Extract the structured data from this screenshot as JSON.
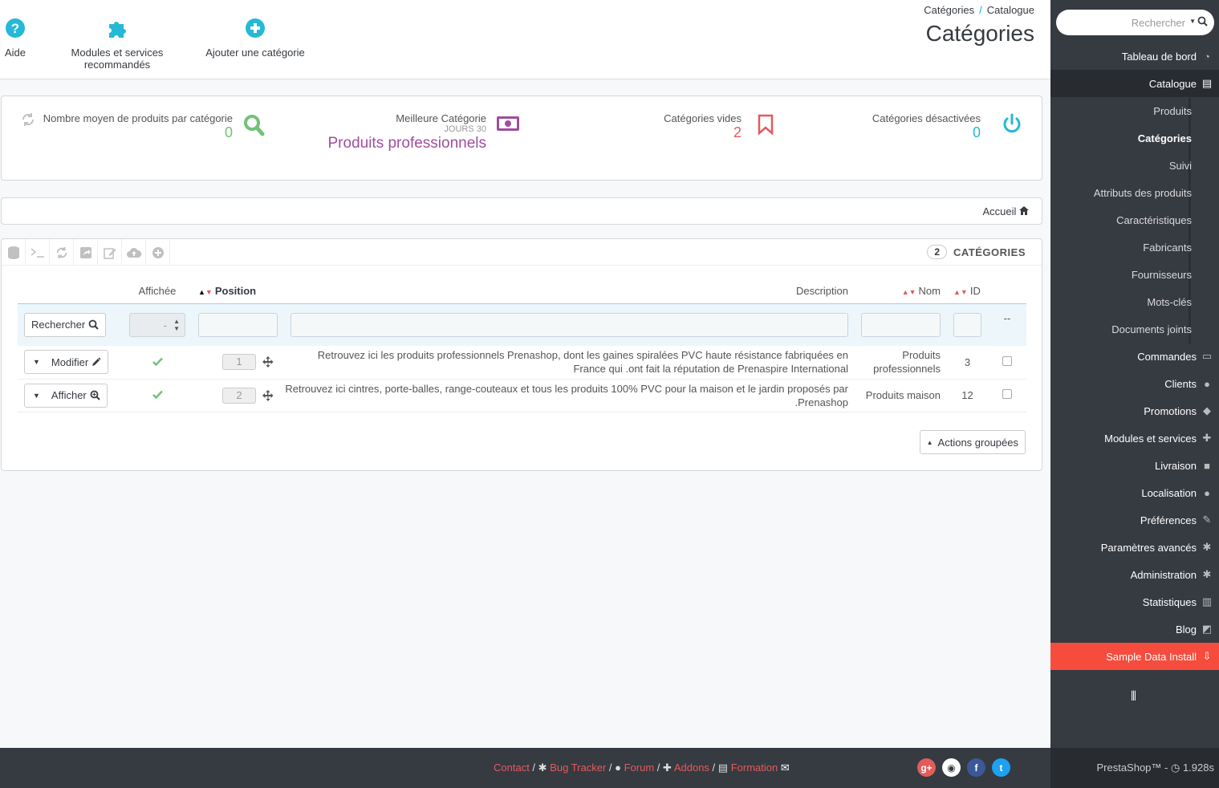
{
  "toolbar": {
    "help": "Aide",
    "modules": "Modules et services recommandés",
    "add": "Ajouter une catégorie"
  },
  "breadcrumb": {
    "parent": "Catégories",
    "sep": "/",
    "current": "Catalogue"
  },
  "page_title": "Catégories",
  "kpis": {
    "avg": {
      "title": "Nombre moyen de produits par catégorie",
      "value": "0"
    },
    "best": {
      "title": "Meilleure Catégorie",
      "sub": "JOURS 30",
      "value": "Produits professionnels"
    },
    "empty": {
      "title": "Catégories vides",
      "value": "2"
    },
    "disabled": {
      "title": "Catégories désactivées",
      "value": "0"
    }
  },
  "path": {
    "home": "Accueil"
  },
  "list": {
    "count": "2",
    "title": "CATÉGORIES",
    "columns": {
      "displayed": "Affichée",
      "position": "Position",
      "description": "Description",
      "name": "Nom",
      "id": "ID"
    },
    "search_button": "Rechercher",
    "select_placeholder": "-",
    "dash": "--",
    "rows": [
      {
        "action": "Modifier",
        "position": "1",
        "description": "Retrouvez ici les produits professionnels Prenashop, dont les gaines spiralées PVC haute résistance fabriquées en France qui .ont fait la réputation de Prenaspire International",
        "name": "Produits professionnels",
        "id": "3"
      },
      {
        "action": "Afficher",
        "position": "2",
        "description": "Retrouvez ici cintres, porte-balles, range-couteaux et tous les produits 100% PVC pour la maison et le jardin proposés par .Prenashop",
        "name": "Produits maison",
        "id": "12"
      }
    ],
    "bulk": "Actions groupées"
  },
  "sidebar": {
    "search_placeholder": "Rechercher",
    "items": [
      {
        "label": "Tableau de bord"
      },
      {
        "label": "Catalogue"
      },
      {
        "label": "Produits"
      },
      {
        "label": "Catégories"
      },
      {
        "label": "Suivi"
      },
      {
        "label": "Attributs des produits"
      },
      {
        "label": "Caractéristiques"
      },
      {
        "label": "Fabricants"
      },
      {
        "label": "Fournisseurs"
      },
      {
        "label": "Mots-clés"
      },
      {
        "label": "Documents joints"
      },
      {
        "label": "Commandes"
      },
      {
        "label": "Clients"
      },
      {
        "label": "Promotions"
      },
      {
        "label": "Modules et services"
      },
      {
        "label": "Livraison"
      },
      {
        "label": "Localisation"
      },
      {
        "label": "Préférences"
      },
      {
        "label": "Paramètres avancés"
      },
      {
        "label": "Administration"
      },
      {
        "label": "Statistiques"
      },
      {
        "label": "Blog"
      },
      {
        "label": "Sample Data Install"
      }
    ]
  },
  "footer": {
    "contact": "Contact",
    "bug": "Bug Tracker",
    "forum": "Forum",
    "addons": "Addons",
    "formation": "Formation",
    "version": "PrestaShop™ -",
    "time": "1.928s"
  },
  "colors": {
    "accent": "#25b9d7",
    "green": "#72c279",
    "red": "#e35b5a",
    "purple": "#a04d9e",
    "sidebar": "#363a41"
  }
}
